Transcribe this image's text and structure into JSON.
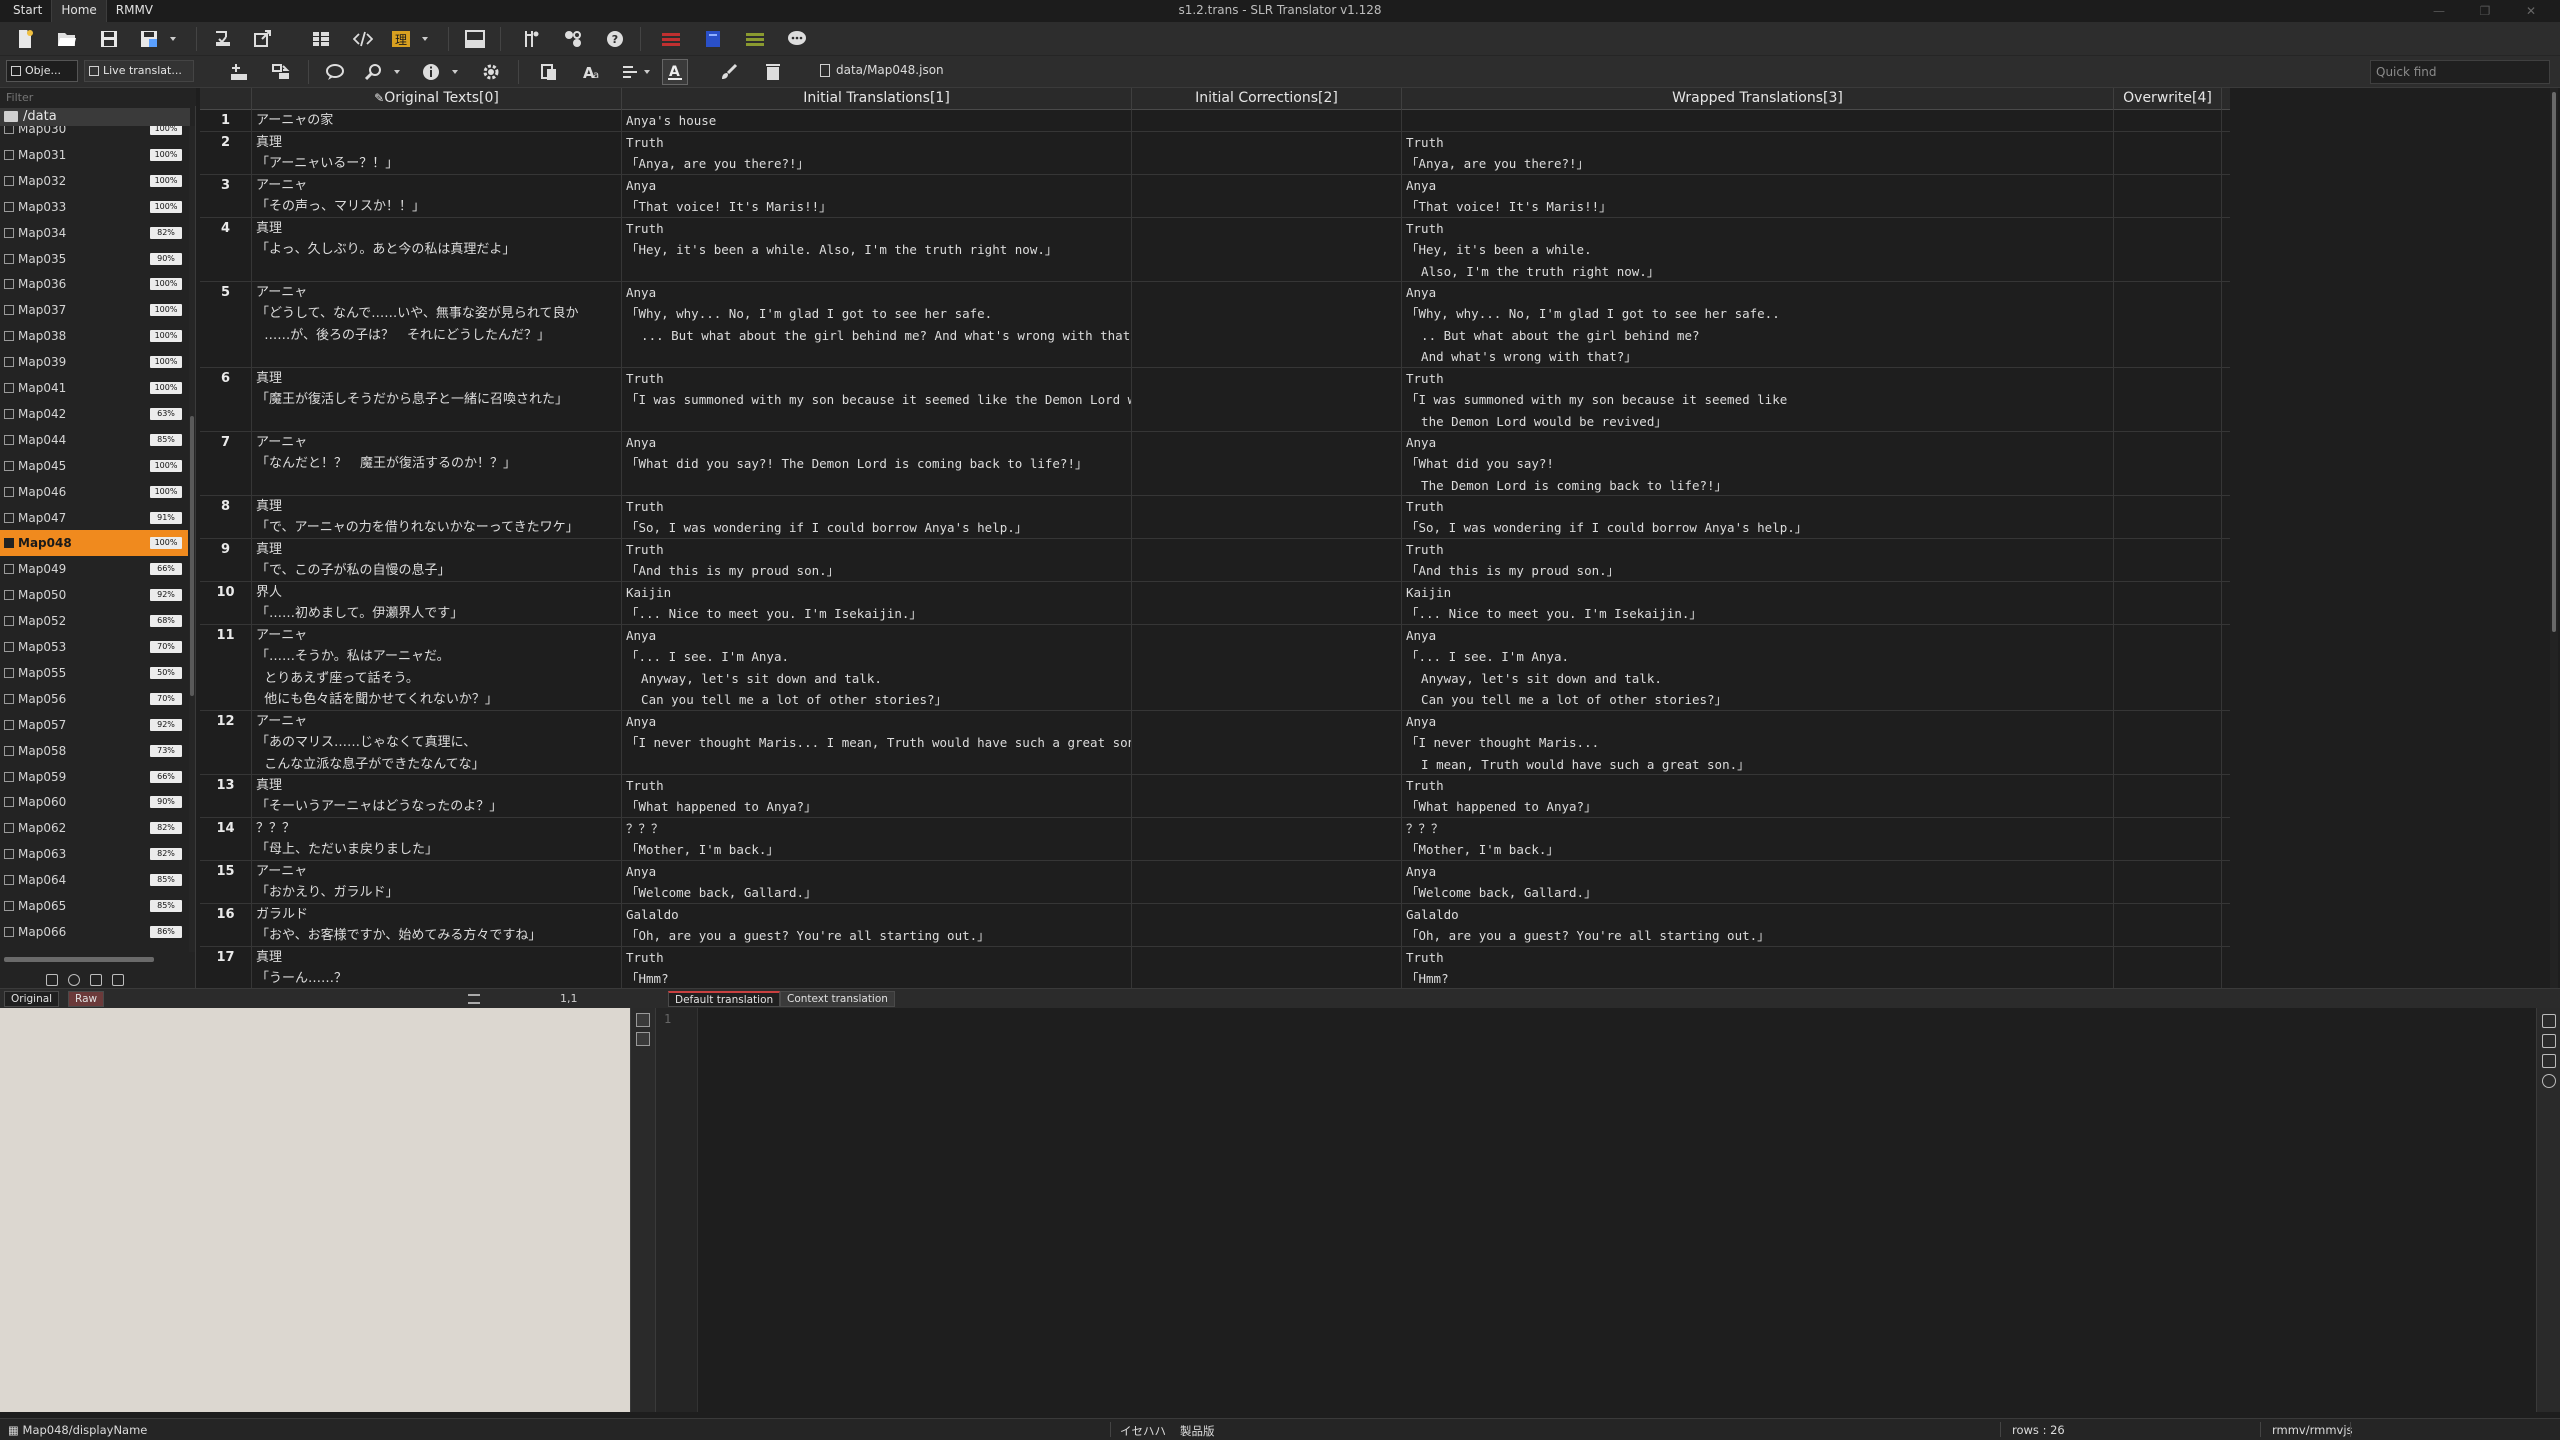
{
  "window": {
    "title": "s1.2.trans - SLR Translator v1.128",
    "menu": [
      "Start",
      "Home",
      "RMMV"
    ],
    "controls": [
      "—",
      "❐",
      "✕"
    ]
  },
  "toolbar": {
    "file_path": "data/Map048.json",
    "quick_find_placeholder": "Quick find",
    "left_tabs": [
      "Obje...",
      "Live translat..."
    ]
  },
  "left_panel": {
    "filter_placeholder": "Filter",
    "root": "/data",
    "maps": [
      {
        "name": "Map030",
        "pct": "100%"
      },
      {
        "name": "Map031",
        "pct": "100%"
      },
      {
        "name": "Map032",
        "pct": "100%"
      },
      {
        "name": "Map033",
        "pct": "100%"
      },
      {
        "name": "Map034",
        "pct": "82%"
      },
      {
        "name": "Map035",
        "pct": "90%"
      },
      {
        "name": "Map036",
        "pct": "100%"
      },
      {
        "name": "Map037",
        "pct": "100%"
      },
      {
        "name": "Map038",
        "pct": "100%"
      },
      {
        "name": "Map039",
        "pct": "100%"
      },
      {
        "name": "Map041",
        "pct": "100%"
      },
      {
        "name": "Map042",
        "pct": "63%"
      },
      {
        "name": "Map044",
        "pct": "85%"
      },
      {
        "name": "Map045",
        "pct": "100%"
      },
      {
        "name": "Map046",
        "pct": "100%"
      },
      {
        "name": "Map047",
        "pct": "91%"
      },
      {
        "name": "Map048",
        "pct": "100%",
        "selected": true
      },
      {
        "name": "Map049",
        "pct": "66%"
      },
      {
        "name": "Map050",
        "pct": "92%"
      },
      {
        "name": "Map052",
        "pct": "68%"
      },
      {
        "name": "Map053",
        "pct": "70%"
      },
      {
        "name": "Map055",
        "pct": "50%"
      },
      {
        "name": "Map056",
        "pct": "70%"
      },
      {
        "name": "Map057",
        "pct": "92%"
      },
      {
        "name": "Map058",
        "pct": "73%"
      },
      {
        "name": "Map059",
        "pct": "66%"
      },
      {
        "name": "Map060",
        "pct": "90%"
      },
      {
        "name": "Map062",
        "pct": "82%"
      },
      {
        "name": "Map063",
        "pct": "82%"
      },
      {
        "name": "Map064",
        "pct": "85%"
      },
      {
        "name": "Map065",
        "pct": "85%"
      },
      {
        "name": "Map066",
        "pct": "86%"
      }
    ]
  },
  "grid": {
    "headers": [
      "Original Texts[0]",
      "Initial Translations[1]",
      "Initial Corrections[2]",
      "Wrapped Translations[3]",
      "Overwrite[4]"
    ],
    "rows": [
      {
        "n": "1",
        "orig": "アーニャの家",
        "init": "Anya's house",
        "corr": "",
        "wrap": "",
        "over": ""
      },
      {
        "n": "2",
        "orig": "真理\n「アーニャいるー？！」",
        "init": "Truth\n「Anya, are you there?!」",
        "corr": "",
        "wrap": "Truth\n「Anya, are you there?!」",
        "over": ""
      },
      {
        "n": "3",
        "orig": "アーニャ\n「その声っ、マリスか！！」",
        "init": "Anya\n「That voice! It's Maris!!」",
        "corr": "",
        "wrap": "Anya\n「That voice! It's Maris!!」",
        "over": ""
      },
      {
        "n": "4",
        "orig": "真理\n「よっ、久しぶり。あと今の私は真理だよ」",
        "init": "Truth\n「Hey, it's been a while. Also, I'm the truth right now.」",
        "corr": "",
        "wrap": "Truth\n「Hey, it's been a while.\n  Also, I'm the truth right now.」",
        "over": ""
      },
      {
        "n": "5",
        "orig": "アーニャ\n「どうして、なんで……いや、無事な姿が見られて良か\n  ……が、後ろの子は？　それにどうしたんだ？」",
        "init": "Anya\n「Why, why... No, I'm glad I got to see her safe.\n  ... But what about the girl behind me? And what's wrong with that?」",
        "corr": "",
        "wrap": "Anya\n「Why, why... No, I'm glad I got to see her safe..\n  .. But what about the girl behind me?\n  And what's wrong with that?」",
        "over": ""
      },
      {
        "n": "6",
        "orig": "真理\n「魔王が復活しそうだから息子と一緒に召喚された」",
        "init": "Truth\n「I was summoned with my son because it seemed like the Demon Lord would be revived」",
        "corr": "",
        "wrap": "Truth\n「I was summoned with my son because it seemed like\n  the Demon Lord would be revived」",
        "over": ""
      },
      {
        "n": "7",
        "orig": "アーニャ\n「なんだと！？　魔王が復活するのか！？」",
        "init": "Anya\n「What did you say?! The Demon Lord is coming back to life?!」",
        "corr": "",
        "wrap": "Anya\n「What did you say?!\n  The Demon Lord is coming back to life?!」",
        "over": ""
      },
      {
        "n": "8",
        "orig": "真理\n「で、アーニャの力を借りれないかなーってきたワケ」",
        "init": "Truth\n「So, I was wondering if I could borrow Anya's help.」",
        "corr": "",
        "wrap": "Truth\n「So, I was wondering if I could borrow Anya's help.」",
        "over": ""
      },
      {
        "n": "9",
        "orig": "真理\n「で、この子が私の自慢の息子」",
        "init": "Truth\n「And this is my proud son.」",
        "corr": "",
        "wrap": "Truth\n「And this is my proud son.」",
        "over": ""
      },
      {
        "n": "10",
        "orig": "界人\n「……初めまして。伊瀬界人です」",
        "init": "Kaijin\n「... Nice to meet you. I'm Isekaijin.」",
        "corr": "",
        "wrap": "Kaijin\n「... Nice to meet you. I'm Isekaijin.」",
        "over": ""
      },
      {
        "n": "11",
        "orig": "アーニャ\n「……そうか。私はアーニャだ。\n  とりあえず座って話そう。\n  他にも色々話を聞かせてくれないか？」",
        "init": "Anya\n「... I see. I'm Anya.\n  Anyway, let's sit down and talk.\n  Can you tell me a lot of other stories?」",
        "corr": "",
        "wrap": "Anya\n「... I see. I'm Anya.\n  Anyway, let's sit down and talk.\n  Can you tell me a lot of other stories?」",
        "over": ""
      },
      {
        "n": "12",
        "orig": "アーニャ\n「あのマリス……じゃなくて真理に、\n  こんな立派な息子ができたなんてな」",
        "init": "Anya\n「I never thought Maris... I mean, Truth would have such a great son.」",
        "corr": "",
        "wrap": "Anya\n「I never thought Maris...\n  I mean, Truth would have such a great son.」",
        "over": ""
      },
      {
        "n": "13",
        "orig": "真理\n「そーいうアーニャはどうなったのよ？」",
        "init": "Truth\n「What happened to Anya?」",
        "corr": "",
        "wrap": "Truth\n「What happened to Anya?」",
        "over": ""
      },
      {
        "n": "14",
        "orig": "？？？\n「母上、ただいま戻りました」",
        "init": "？？？\n「Mother, I'm back.」",
        "corr": "",
        "wrap": "？？？\n「Mother, I'm back.」",
        "over": ""
      },
      {
        "n": "15",
        "orig": "アーニャ\n「おかえり、ガラルド」",
        "init": "Anya\n「Welcome back, Gallard.」",
        "corr": "",
        "wrap": "Anya\n「Welcome back, Gallard.」",
        "over": ""
      },
      {
        "n": "16",
        "orig": "ガラルド\n「おや、お客様ですか、始めてみる方々ですね」",
        "init": "Galaldo\n「Oh, are you a guest? You're all starting out.」",
        "corr": "",
        "wrap": "Galaldo\n「Oh, are you a guest? You're all starting out.」",
        "over": ""
      },
      {
        "n": "17",
        "orig": "真理\n「うーん……？",
        "init": "Truth\n「Hmm?",
        "corr": "",
        "wrap": "Truth\n「Hmm?",
        "over": ""
      }
    ]
  },
  "bottom": {
    "left_tabs": [
      "Original",
      "Raw"
    ],
    "cursor_pos": "1,1",
    "editor_tabs": [
      "Default translation",
      "Context translation"
    ],
    "line_number": "1"
  },
  "status": {
    "path": "Map048/displayName",
    "mid1": "イセハハ",
    "mid2": "製品版",
    "rows": "rows : 26",
    "engine": "rmmv/rmmvjs"
  },
  "colors": {
    "selection": "#f08a1e",
    "raw_tab": "#6b3a3a",
    "original_pane": "#dcd7d0"
  }
}
